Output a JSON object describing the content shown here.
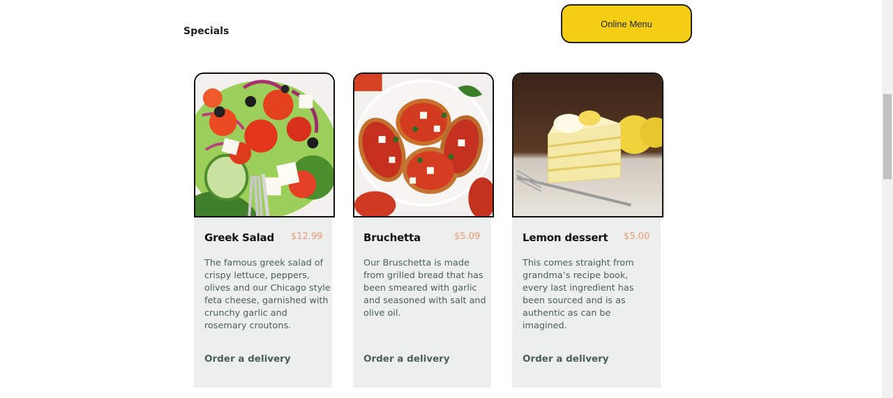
{
  "section": {
    "title": "Specials"
  },
  "header": {
    "online_menu_label": "Online Menu"
  },
  "cards": [
    {
      "name": "Greek Salad",
      "price": "$12.99",
      "description": "The famous greek salad of crispy lettuce, peppers, olives and our Chicago style feta cheese, garnished with crunchy garlic and rosemary croutons.",
      "order_label": "Order a delivery",
      "image_icon": "greek-salad-photo"
    },
    {
      "name": "Bruchetta",
      "price": "$5.09",
      "description": "Our Bruschetta is made from grilled bread that has been smeared with garlic and seasoned with salt and olive oil.",
      "order_label": "Order a delivery",
      "image_icon": "bruschetta-photo"
    },
    {
      "name": "Lemon dessert",
      "price": "$5.00",
      "description": "This comes straight from grandma’s recipe book, every last ingredient has been sourced and is as authentic as can be imagined.",
      "order_label": "Order a delivery",
      "image_icon": "lemon-dessert-photo"
    }
  ],
  "colors": {
    "accent_yellow": "#f4ce14",
    "price_salmon": "#ee9972",
    "card_bg": "#edefee",
    "text_green": "#495e57"
  }
}
